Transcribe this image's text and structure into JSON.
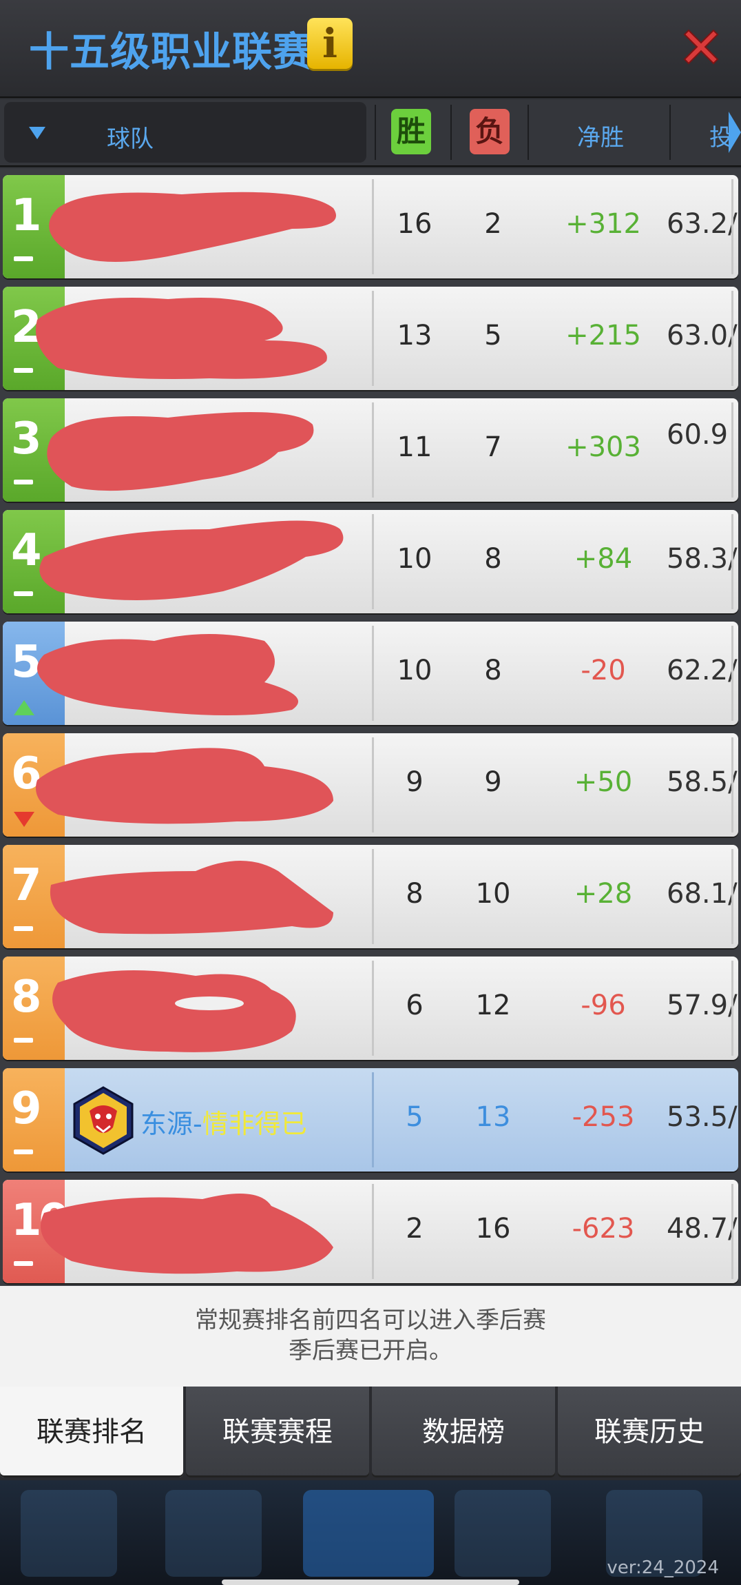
{
  "header": {
    "title": "十五级职业联赛",
    "info_glyph": "i"
  },
  "columns": {
    "team": "球队",
    "wins": "胜",
    "losses": "负",
    "net": "净胜",
    "rate": "投"
  },
  "rows": [
    {
      "rank": "1",
      "trend": "same",
      "wins": "16",
      "losses": "2",
      "net": "+312",
      "rate": "63.2/"
    },
    {
      "rank": "2",
      "trend": "same",
      "wins": "13",
      "losses": "5",
      "net": "+215",
      "rate": "63.0/"
    },
    {
      "rank": "3",
      "trend": "same",
      "wins": "11",
      "losses": "7",
      "net": "+303",
      "rate": "60.9"
    },
    {
      "rank": "4",
      "trend": "same",
      "wins": "10",
      "losses": "8",
      "net": "+84",
      "rate": "58.3/"
    },
    {
      "rank": "5",
      "trend": "up",
      "wins": "10",
      "losses": "8",
      "net": "-20",
      "rate": "62.2/"
    },
    {
      "rank": "6",
      "trend": "down",
      "wins": "9",
      "losses": "9",
      "net": "+50",
      "rate": "58.5/"
    },
    {
      "rank": "7",
      "trend": "same",
      "wins": "8",
      "losses": "10",
      "net": "+28",
      "rate": "68.1/"
    },
    {
      "rank": "8",
      "trend": "same",
      "wins": "6",
      "losses": "12",
      "net": "-96",
      "rate": "57.9/"
    },
    {
      "rank": "9",
      "trend": "same",
      "wins": "5",
      "losses": "13",
      "net": "-253",
      "rate": "53.5/",
      "team_prefix": "东源-",
      "team_name": "情非得已"
    },
    {
      "rank": "10",
      "trend": "same",
      "wins": "2",
      "losses": "16",
      "net": "-623",
      "rate": "48.7/"
    }
  ],
  "notice": {
    "line1": "常规赛排名前四名可以进入季后赛",
    "line2": "季后赛已开启。"
  },
  "tabs": [
    {
      "label": "联赛排名",
      "active": true
    },
    {
      "label": "联赛赛程",
      "active": false
    },
    {
      "label": "数据榜",
      "active": false
    },
    {
      "label": "联赛历史",
      "active": false
    }
  ],
  "footer": {
    "version": "ver:24_2024"
  },
  "colors": {
    "title_blue": "#4ea3ee",
    "win_green": "#6ccf3d",
    "loss_red": "#e06059",
    "redaction": "#e05458",
    "highlight_row": "#b8d0ec"
  }
}
